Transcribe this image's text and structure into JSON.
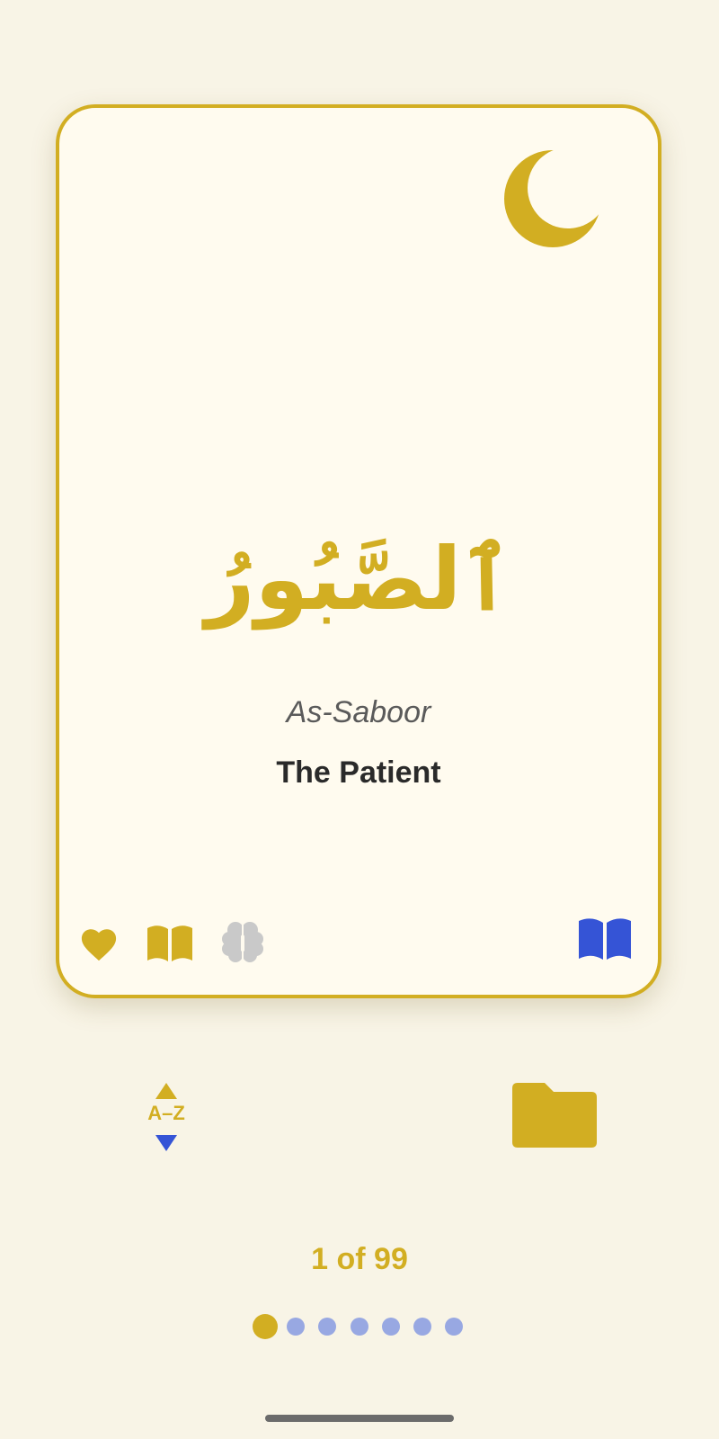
{
  "card": {
    "arabic_name": "ٱلصَّبُورُ",
    "transliteration": "As-Saboor",
    "meaning": "The Patient",
    "icons": {
      "corner": "crescent-moon-icon",
      "favorite": "heart-icon",
      "read": "open-book-icon",
      "memorize": "brain-icon",
      "details": "open-book-icon"
    }
  },
  "controls": {
    "sort_label": "A–Z",
    "folder_icon": "folder-icon"
  },
  "pager": {
    "counter_text": "1 of 99",
    "current": 1,
    "total": 99,
    "visible_dots": 7,
    "active_dot": 0
  },
  "colors": {
    "background": "#F8F4E6",
    "card": "#FFFBEF",
    "gold": "#D2AE22",
    "blue": "#3554D6",
    "dot_inactive": "#98A8E2",
    "grey_icon": "#C9C9C9"
  }
}
